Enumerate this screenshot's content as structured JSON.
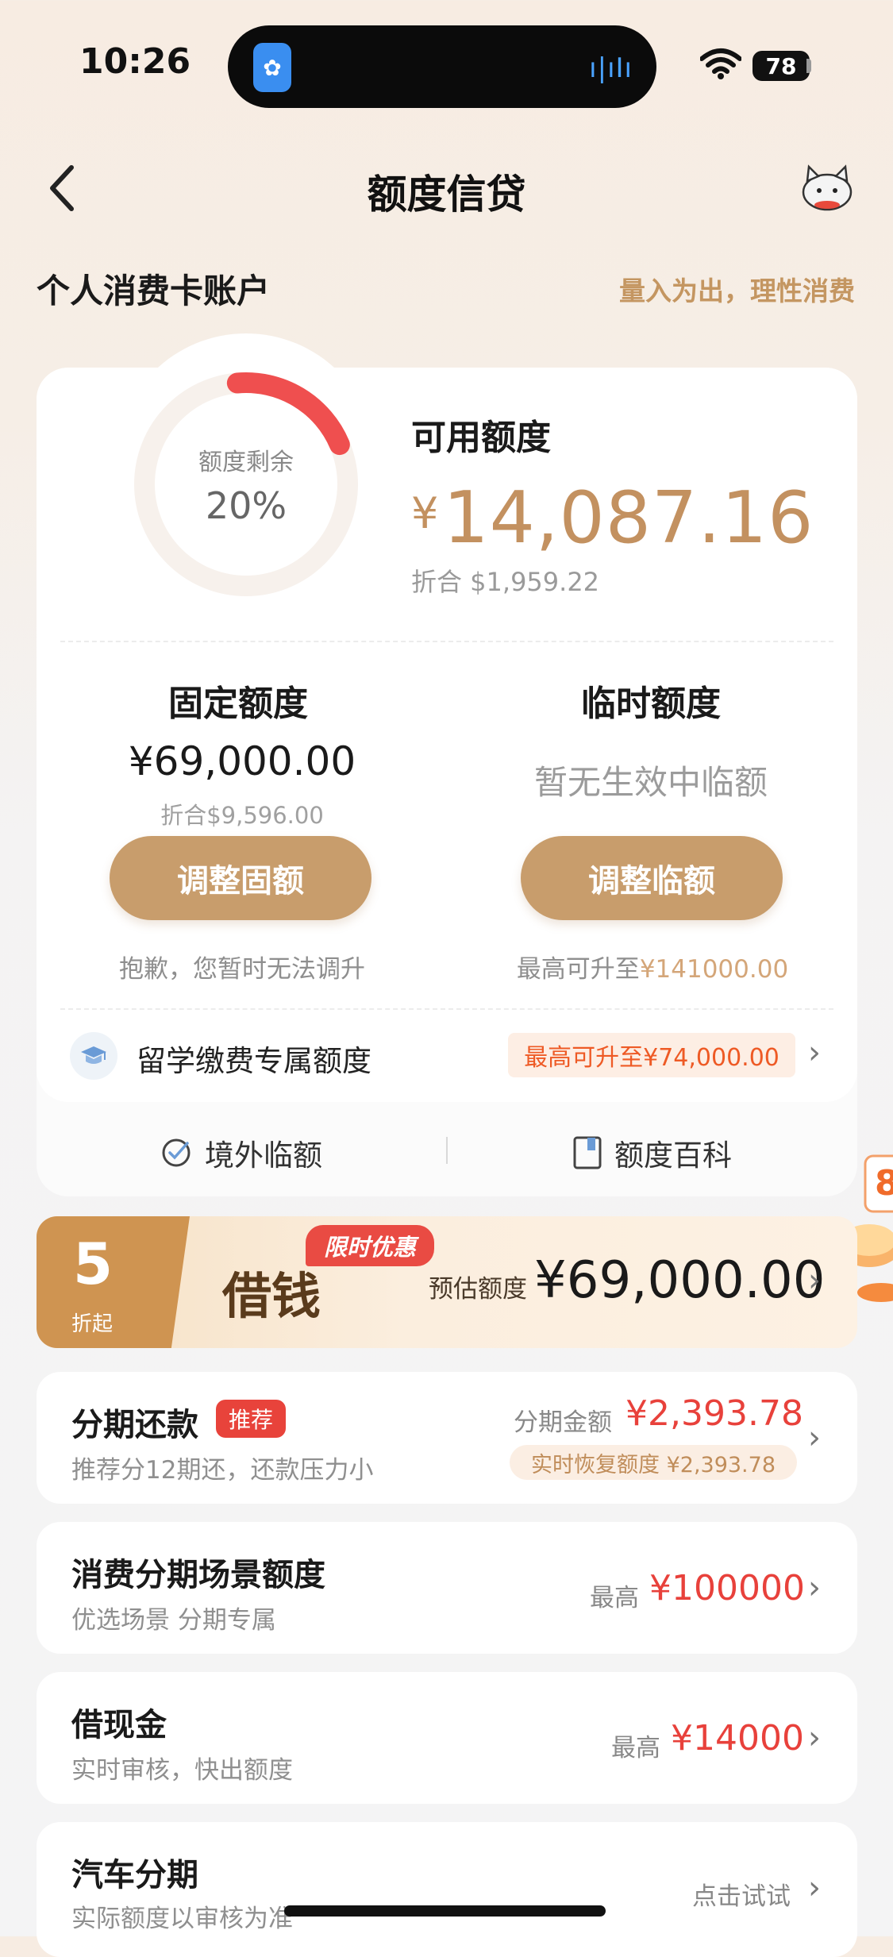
{
  "status_bar": {
    "time": "10:26",
    "battery": "78"
  },
  "nav": {
    "title": "额度信贷"
  },
  "account": {
    "title": "个人消费卡账户",
    "slogan": "量入为出，理性消费"
  },
  "credit": {
    "ring_label": "额度剩余",
    "ring_percent": "20%",
    "ring_fraction": 0.2,
    "available_label": "可用额度",
    "available_currency": "¥",
    "available_amount": "14,087.16",
    "available_converted": "折合 $1,959.22"
  },
  "fixed": {
    "title": "固定额度",
    "amount": "¥69,000.00",
    "converted": "折合$9,596.00",
    "button": "调整固额",
    "note": "抱歉，您暂时无法调升"
  },
  "temporary": {
    "title": "临时额度",
    "status": "暂无生效中临额",
    "button": "调整临额",
    "note_prefix": "最高可升至",
    "note_amount": "¥141000.00"
  },
  "study": {
    "label": "留学缴费专属额度",
    "badge": "最高可升至¥74,000.00"
  },
  "links": {
    "overseas": "境外临额",
    "wiki": "额度百科"
  },
  "promo": {
    "discount": "5",
    "discount_unit": "折起",
    "title": "借钱",
    "tag": "限时优惠",
    "est_label": "预估额度",
    "est_amount": "¥69,000.00",
    "side_badge": "8"
  },
  "installment": {
    "title": "分期还款",
    "tag": "推荐",
    "subtitle": "推荐分12期还，还款压力小",
    "amount_label": "分期金额",
    "amount": "¥2,393.78",
    "restore": "实时恢复额度 ¥2,393.78"
  },
  "consume": {
    "title": "消费分期场景额度",
    "subtitle": "优选场景 分期专属",
    "max_label": "最高",
    "max_amount": "¥100000"
  },
  "cash": {
    "title": "借现金",
    "subtitle": "实时审核，快出额度",
    "max_label": "最高",
    "max_amount": "¥14000"
  },
  "car": {
    "title": "汽车分期",
    "subtitle": "实际额度以审核为准",
    "action": "点击试试"
  },
  "colors": {
    "accent": "#c89d6c",
    "gold_text": "#c39160",
    "red": "#e8413b",
    "ring_red": "#ef4f4f"
  }
}
